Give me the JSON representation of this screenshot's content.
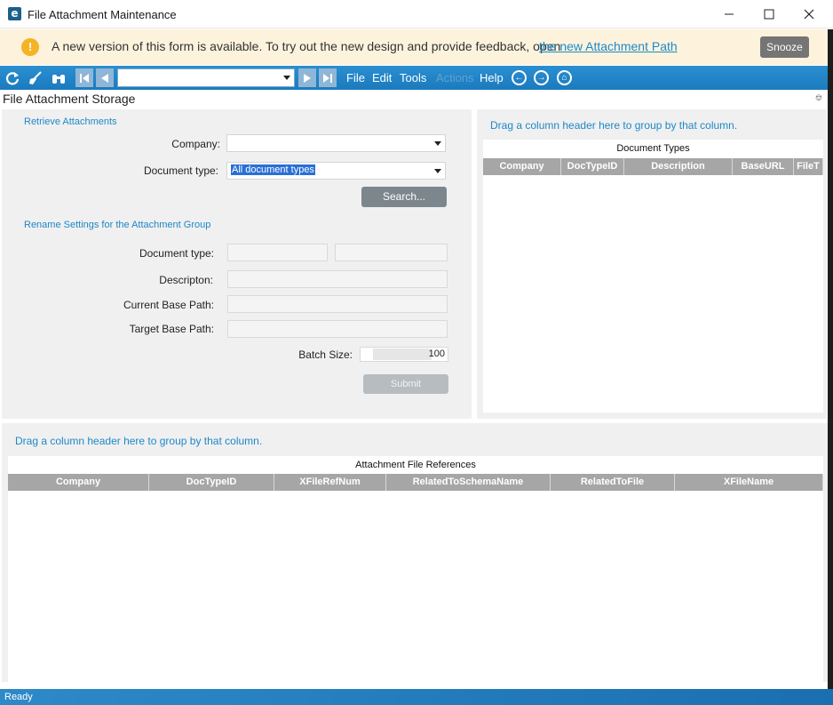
{
  "window": {
    "title": "File Attachment Maintenance",
    "app_icon": "e",
    "controls": [
      "minimize-icon",
      "maximize-icon",
      "close-icon"
    ]
  },
  "banner": {
    "icon": "!",
    "message": "A new version of this form is available. To try out the new design and provide feedback, open",
    "link_text": "the new Attachment Path",
    "snooze_label": "Snooze",
    "background": "#fdf3dd"
  },
  "toolbar": {
    "icons": [
      "refresh-icon",
      "clear-icon",
      "binoculars-icon",
      "first-record-icon",
      "previous-record-icon",
      "next-record-icon",
      "last-record-icon"
    ],
    "record_selector_value": "",
    "menus": {
      "file": "File",
      "edit": "Edit",
      "tools": "Tools",
      "actions": "Actions",
      "help": "Help"
    },
    "accent": "#1b7abe"
  },
  "section": {
    "title": "File Attachment Storage"
  },
  "retrieve": {
    "title": "Retrieve Attachments",
    "company_label": "Company:",
    "company_value": "",
    "doc_type_label": "Document type:",
    "doc_type_value": "All document types",
    "search_label": "Search..."
  },
  "rename": {
    "title": "Rename Settings for the Attachment Group",
    "doc_type_label": "Document type:",
    "description_label": "Descripton:",
    "current_base_label": "Current  Base Path:",
    "target_base_label": "Target  Base Path:",
    "batch_label": "Batch Size:",
    "batch_value": "100",
    "submit_label": "Submit"
  },
  "doc_types_grid": {
    "drag_hint": "Drag a column header here to group by that column.",
    "caption": "Document Types",
    "columns": [
      "Company",
      "DocTypeID",
      "Description",
      "BaseURL",
      "FileT"
    ],
    "rows": []
  },
  "references_grid": {
    "drag_hint": "Drag a column header here to group by that column.",
    "caption": "Attachment File References",
    "columns": [
      "Company",
      "DocTypeID",
      "XFileRefNum",
      "RelatedToSchemaName",
      "RelatedToFile",
      "XFileName"
    ],
    "rows": []
  },
  "status": {
    "text": "Ready"
  }
}
